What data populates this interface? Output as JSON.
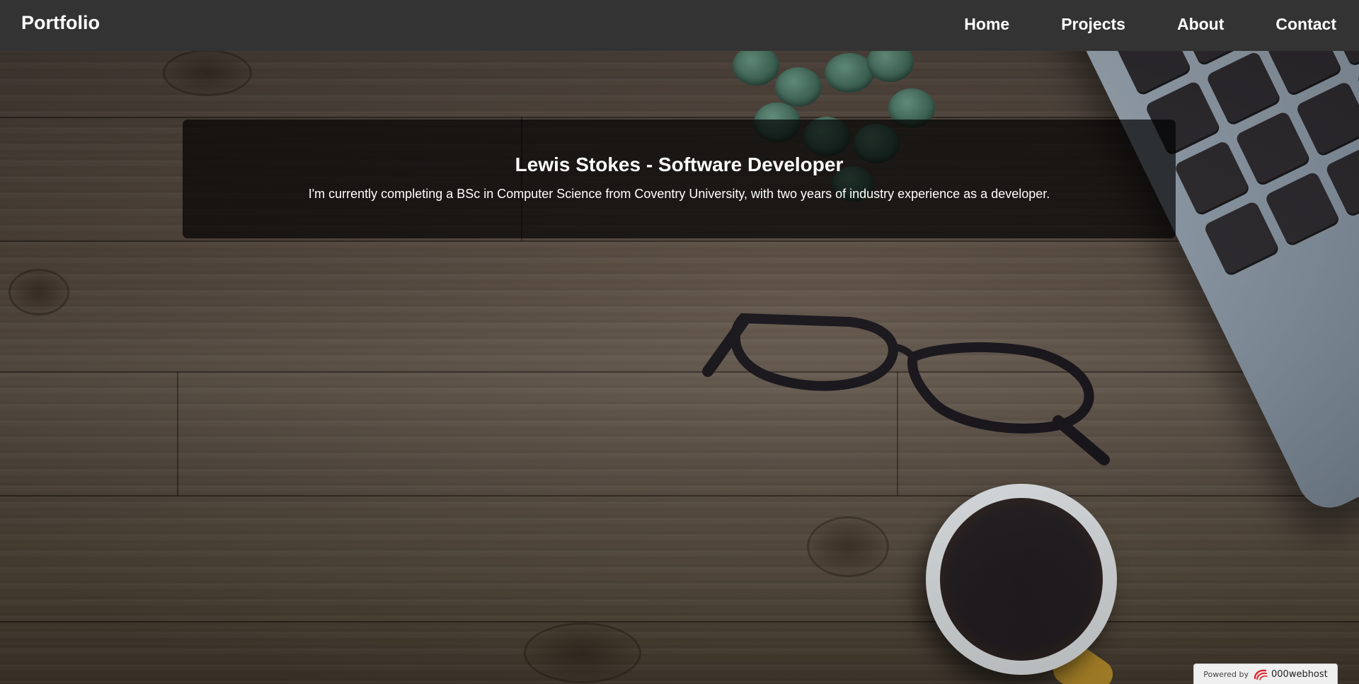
{
  "navbar": {
    "brand": "Portfolio",
    "links": [
      {
        "label": "Home"
      },
      {
        "label": "Projects"
      },
      {
        "label": "About"
      },
      {
        "label": "Contact"
      }
    ]
  },
  "hero": {
    "title": "Lewis Stokes - Software Developer",
    "text": "I'm currently completing a BSc in Computer Science from Coventry University, with two years of industry experience as a developer."
  },
  "background": {
    "description_icons": [
      "plant-icon",
      "laptop-icon",
      "glasses-icon",
      "coffee-cup-icon"
    ]
  },
  "badge": {
    "prefix": "Powered by",
    "brand": "000webhost",
    "accent": "#e0262d"
  },
  "colors": {
    "navbar_bg": "#333333",
    "nav_text": "#ffffff",
    "hero_overlay": "rgba(0,0,0,0.68)"
  }
}
